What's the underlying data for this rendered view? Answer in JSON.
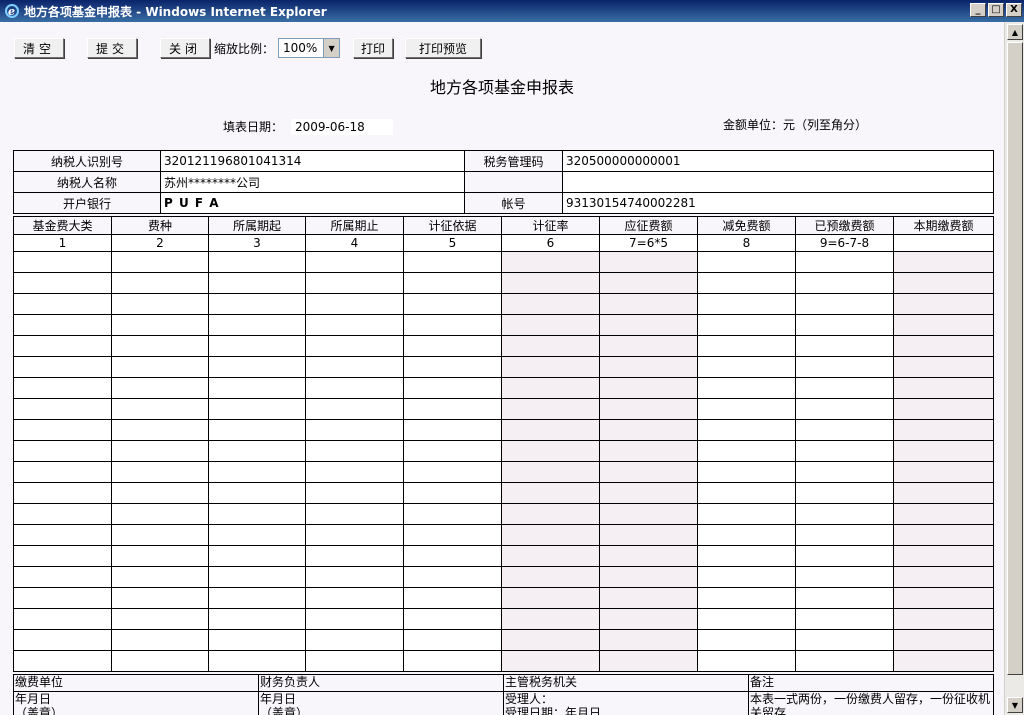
{
  "window": {
    "title": "地方各项基金申报表 - Windows Internet Explorer",
    "minimize": "_",
    "maximize": "□",
    "close": "X"
  },
  "toolbar": {
    "clear_label": "清空",
    "submit_label": "提交",
    "close_label": "关闭",
    "zoom_label": "缩放比例：",
    "zoom_value": "100%",
    "print_label": "打印",
    "preview_label": "打印预览"
  },
  "form": {
    "title": "地方各项基金申报表",
    "fill_date_label": "填表日期：",
    "fill_date_value": "2009-06-18",
    "unit_label": "金额单位：元（列至角分）"
  },
  "info": {
    "taxpayer_id_label": "纳税人识别号",
    "taxpayer_id_value": "320121196801041314",
    "tax_code_label": "税务管理码",
    "tax_code_value": "320500000000001",
    "taxpayer_name_label": "纳税人名称",
    "taxpayer_name_value": "苏州********公司",
    "bank_label": "开户银行",
    "bank_value": "P U F A",
    "account_label": "帐号",
    "account_value": "93130154740002281"
  },
  "grid": {
    "columns": [
      "基金费大类",
      "费种",
      "所属期起",
      "所属期止",
      "计征依据",
      "计征率",
      "应征费额",
      "减免费额",
      "已预缴费额",
      "本期缴费额"
    ],
    "indices": [
      "1",
      "2",
      "3",
      "4",
      "5",
      "6",
      "7=6*5",
      "8",
      "9=6-7-8",
      ""
    ]
  },
  "footer": {
    "headers": [
      "缴费单位",
      "财务负责人",
      "主管税务机关",
      "备注"
    ],
    "cells": [
      [
        "年月日",
        "（盖章）"
      ],
      [
        "年月日",
        "（盖章）"
      ],
      [
        "受理人：",
        "受理日期：年月日"
      ],
      [
        "本表一式两份，一份缴费人留存，一份征收机",
        "关留存"
      ]
    ]
  }
}
